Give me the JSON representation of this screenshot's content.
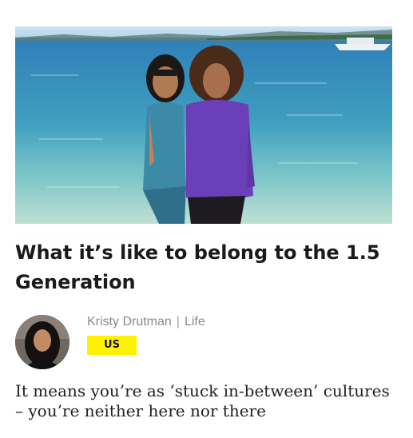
{
  "article": {
    "image_alt": "Two women smiling on a beach with blue water behind them",
    "title": "What it’s like to belong to the 1.5 Generation",
    "author": "Kristy Drutman",
    "separator": "|",
    "category": "Life",
    "tag": "US",
    "dek": "It means you’re as ‘stuck in-between’ cultures – you’re neither here nor there"
  },
  "colors": {
    "tag_bg": "#fff200",
    "meta_text": "#8a8a8a",
    "headline": "#1a1a1a"
  }
}
